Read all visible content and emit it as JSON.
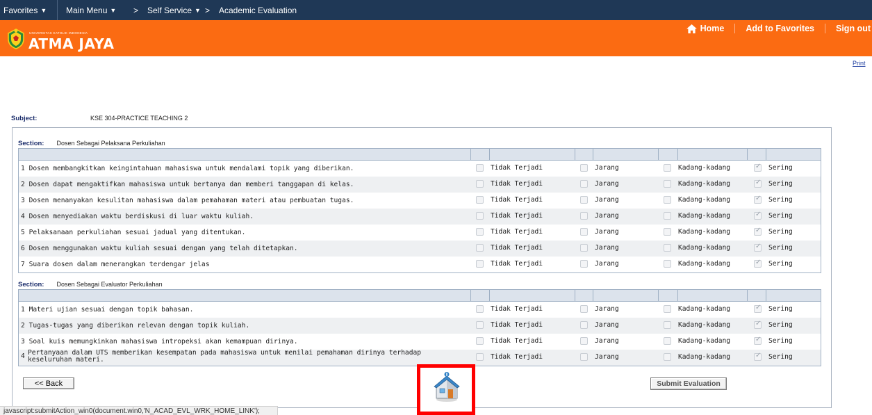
{
  "topnav": {
    "favorites": "Favorites",
    "main_menu": "Main Menu",
    "breadcrumb_sep": ">",
    "self_service": "Self Service",
    "academic_evaluation": "Academic Evaluation"
  },
  "banner": {
    "logo_small": "UNIVERSITAS KATOLIK INDONESIA",
    "logo_big": "ATMA JAYA",
    "home": "Home",
    "add_to_favorites": "Add to Favorites",
    "sign_out": "Sign out"
  },
  "print": "Print",
  "subject": {
    "label": "Subject:",
    "value": "KSE 304-PRACTICE TEACHING 2"
  },
  "options": [
    "Tidak Terjadi",
    "Jarang",
    "Kadang-kadang",
    "Sering"
  ],
  "sections": [
    {
      "label": "Section:",
      "title": "Dosen Sebagai Pelaksana Perkuliahan",
      "questions": [
        {
          "num": "1",
          "text": "Dosen membangkitkan keingintahuan mahasiswa untuk mendalami topik yang diberikan.",
          "selected": "Sering"
        },
        {
          "num": "2",
          "text": "Dosen dapat mengaktifkan mahasiswa untuk bertanya dan memberi tanggapan di kelas.",
          "selected": "Sering"
        },
        {
          "num": "3",
          "text": "Dosen menanyakan kesulitan mahasiswa dalam pemahaman materi atau pembuatan tugas.",
          "selected": "Sering"
        },
        {
          "num": "4",
          "text": "Dosen menyediakan waktu berdiskusi di luar waktu kuliah.",
          "selected": "Sering"
        },
        {
          "num": "5",
          "text": "Pelaksanaan perkuliahan sesuai jadual yang ditentukan.",
          "selected": "Sering"
        },
        {
          "num": "6",
          "text": "Dosen menggunakan waktu kuliah sesuai dengan yang telah ditetapkan.",
          "selected": "Sering"
        },
        {
          "num": "7",
          "text": "Suara dosen dalam menerangkan terdengar jelas",
          "selected": "Sering"
        }
      ]
    },
    {
      "label": "Section:",
      "title": "Dosen Sebagai Evaluator Perkuliahan",
      "questions": [
        {
          "num": "1",
          "text": "Materi ujian sesuai dengan topik bahasan.",
          "selected": "Sering"
        },
        {
          "num": "2",
          "text": "Tugas-tugas yang diberikan relevan dengan topik kuliah.",
          "selected": "Sering"
        },
        {
          "num": "3",
          "text": "Soal kuis memungkinkan mahasiswa intropeksi akan kemampuan dirinya.",
          "selected": "Sering"
        },
        {
          "num": "4",
          "text": "Pertanyaan dalam UTS memberikan kesempatan pada mahasiswa untuk menilai pemahaman dirinya terhadap keseluruhan materi.",
          "selected": "Sering"
        }
      ]
    }
  ],
  "buttons": {
    "back": "<< Back",
    "submit": "Submit Evaluation"
  },
  "status_bar": "javascript:submitAction_win0(document.win0,'N_ACAD_EVL_WRK_HOME_LINK');",
  "icons": {
    "home_link": "home-icon",
    "eval_home": "evaluation-home-icon",
    "logo": "atma-jaya-crest-icon"
  },
  "colors": {
    "nav_bg": "#1f3856",
    "banner_bg": "#fb6b12",
    "highlight": "#ff0000"
  }
}
